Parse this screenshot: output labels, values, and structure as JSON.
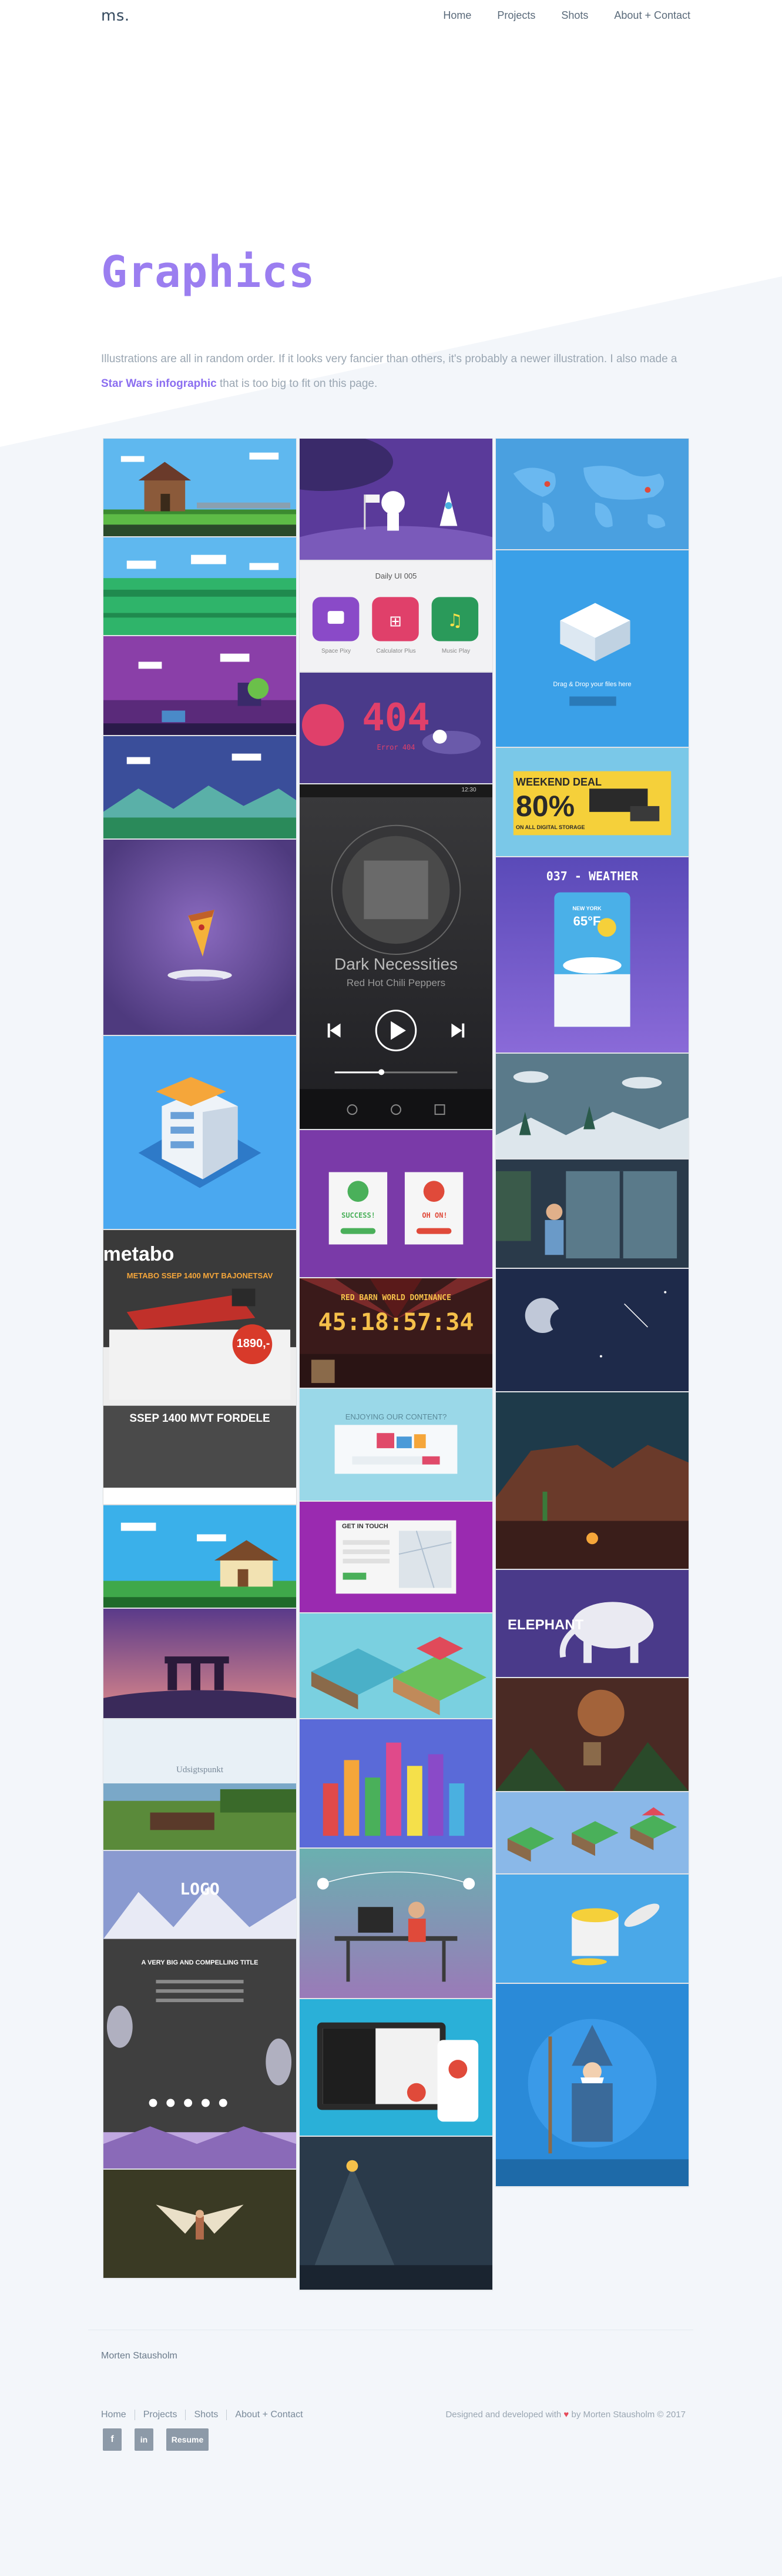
{
  "header": {
    "brand": "ms.",
    "nav": [
      "Home",
      "Projects",
      "Shots",
      "About + Contact"
    ]
  },
  "hero": {
    "title": "Graphics",
    "desc_before": "Illustrations are all in random order. If it looks very fancier than others, it's probably a newer illustration. I also made a ",
    "desc_link": "Star Wars infographic",
    "desc_after": " that is too big to fit on this page."
  },
  "tiles": {
    "app_icons_title": "Daily UI 005",
    "app_icon_labels": [
      "Space Pixy",
      "Calculator Plus",
      "Music Play"
    ],
    "err_code": "404",
    "err_sub": "Error 404",
    "weekend_deal": "WEEKEND DEAL",
    "percent": "80%",
    "storage": "ON ALL DIGITAL STORAGE",
    "music_title": "Dark Necessities",
    "music_artist": "Red Hot Chili Peppers",
    "music_time": "12:30",
    "weather_title": "037 - WEATHER",
    "weather_city": "NEW YORK",
    "weather_temp": "65°F",
    "success": "SUCCESS!",
    "oh_no": "OH ON!",
    "metabo": "metabo",
    "metabo_sub": "METABO SSEP 1400 MVT BAJONETSAV",
    "metabo_price": "1890,-",
    "metabo_fordele": "SSEP 1400 MVT FORDELE",
    "red_barn": "RED BARN WORLD DOMINANCE",
    "countdown": "45:18:57:34",
    "enjoying": "ENJOYING OUR CONTENT?",
    "get_in_touch": "GET IN TOUCH",
    "elephant": "ELEPHANT",
    "drag_drop": "Drag & Drop your files here",
    "logo": "LOGO",
    "compelling": "A VERY BIG AND COMPELLING TITLE",
    "udsigtspunkt": "Udsigtspunkt"
  },
  "footer": {
    "name": "Morten Stausholm",
    "links": [
      "Home",
      "Projects",
      "Shots",
      "About + Contact"
    ],
    "credit_before": "Designed and developed with",
    "heart": "♥",
    "credit_after": "by Morten Stausholm © 2017",
    "facebook": "f",
    "linkedin": "in",
    "resume": "Resume"
  },
  "colors": {
    "accent": "#9b7ef0",
    "link": "#8b6ef0",
    "footer_btn": "#8d9aa8"
  },
  "icons": [
    "facebook-icon",
    "linkedin-icon",
    "heart-icon"
  ]
}
